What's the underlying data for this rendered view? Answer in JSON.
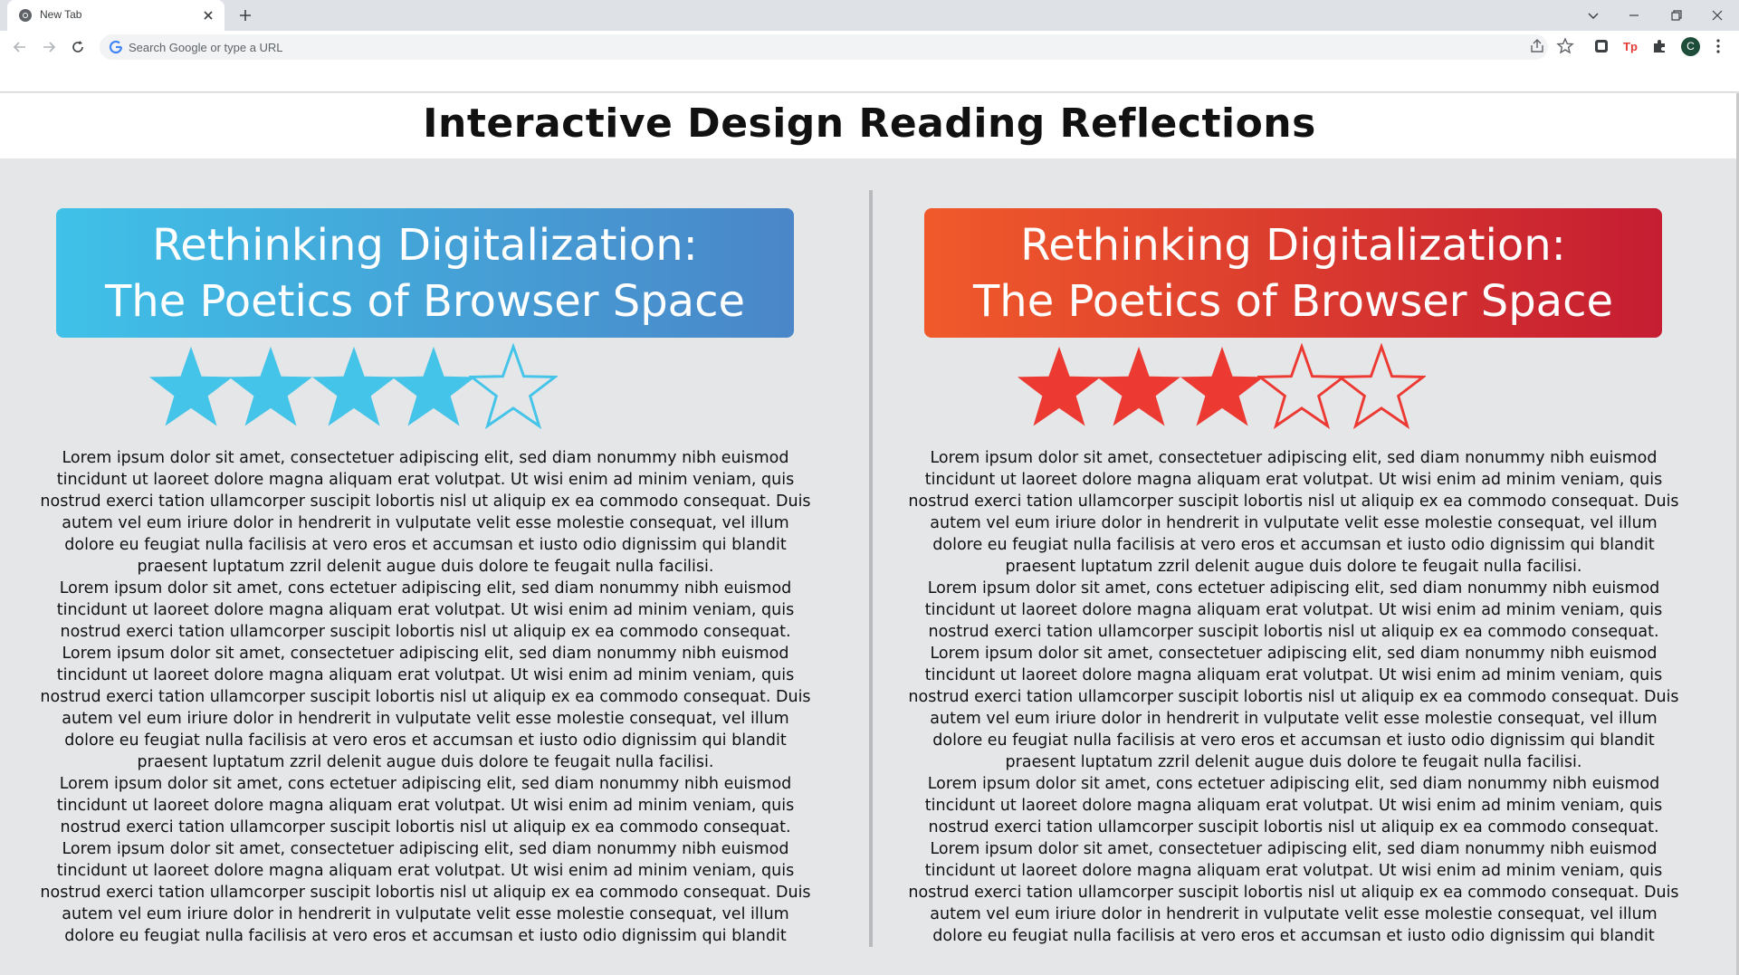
{
  "browser": {
    "tab_title": "New Tab",
    "omnibox_placeholder": "Search Google or type a URL",
    "profile_initial": "C"
  },
  "page": {
    "title": "Interactive Design Reading Reflections"
  },
  "reviews": [
    {
      "theme_color": "#44c4e8",
      "title": "Rethinking Digitalization:\nThe Poetics of Browser Space",
      "rating": 4,
      "max_rating": 5
    },
    {
      "theme_color": "#ec3a33",
      "title": "Rethinking Digitalization:\nThe Poetics of Browser Space",
      "rating": 3,
      "max_rating": 5
    }
  ],
  "paragraphs": [
    "Lorem ipsum dolor sit amet, consectetuer adipiscing elit, sed diam nonummy nibh euismod tincidunt ut laoreet dolore magna aliquam erat volutpat. Ut wisi enim ad minim veniam, quis nostrud exerci tation ullamcorper suscipit lobortis nisl ut aliquip ex ea commodo consequat. Duis autem vel eum iriure dolor in hendrerit in vulputate velit esse molestie consequat, vel illum dolore eu feugiat nulla facilisis at vero eros et accumsan et iusto odio dignissim qui blandit praesent luptatum zzril delenit augue duis dolore te feugait nulla facilisi.",
    "Lorem ipsum dolor sit amet, cons ectetuer adipiscing elit, sed diam nonummy nibh euismod tincidunt ut laoreet dolore magna aliquam erat volutpat. Ut wisi enim ad minim veniam, quis nostrud exerci tation ullamcorper suscipit lobortis nisl ut aliquip ex ea commodo consequat.",
    "Lorem ipsum dolor sit amet, consectetuer adipiscing elit, sed diam nonummy nibh euismod tincidunt ut laoreet dolore magna aliquam erat volutpat. Ut wisi enim ad minim veniam, quis nostrud exerci tation ullamcorper suscipit lobortis nisl ut aliquip ex ea commodo consequat. Duis autem vel eum iriure dolor in hendrerit in vulputate velit esse molestie consequat, vel illum dolore eu feugiat nulla facilisis at vero eros et accumsan et iusto odio dignissim qui blandit praesent luptatum zzril delenit augue duis dolore te feugait nulla facilisi.",
    "Lorem ipsum dolor sit amet, cons ectetuer adipiscing elit, sed diam nonummy nibh euismod tincidunt ut laoreet dolore magna aliquam erat volutpat. Ut wisi enim ad minim veniam, quis nostrud exerci tation ullamcorper suscipit lobortis nisl ut aliquip ex ea commodo consequat.",
    "Lorem ipsum dolor sit amet, consectetuer adipiscing elit, sed diam nonummy nibh euismod tincidunt ut laoreet dolore magna aliquam erat volutpat. Ut wisi enim ad minim veniam, quis nostrud exerci tation ullamcorper suscipit lobortis nisl ut aliquip ex ea commodo consequat. Duis autem vel eum iriure dolor in hendrerit in vulputate velit esse molestie consequat, vel illum dolore eu feugiat nulla facilisis at vero eros et accumsan et iusto odio dignissim qui blandit praesent luptatum zzril delenit augue duis dolore te feugait nulla facilisi."
  ]
}
